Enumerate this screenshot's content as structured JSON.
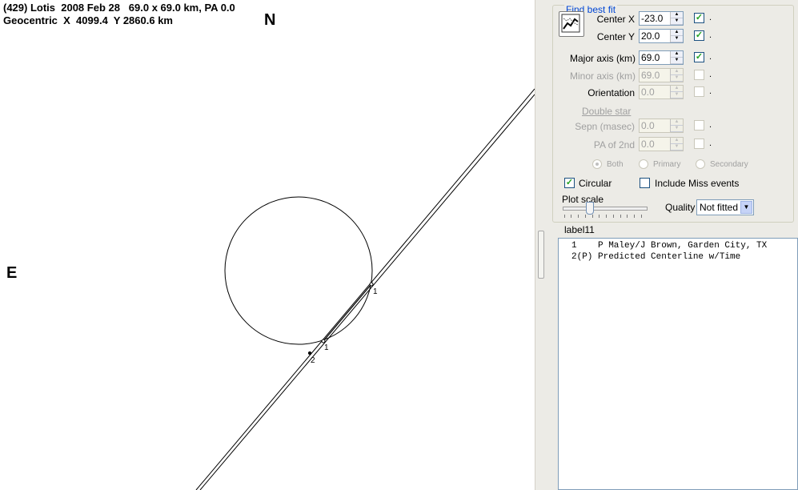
{
  "plot": {
    "header_line1": "(429) Lotis  2008 Feb 28   69.0 x 69.0 km, PA 0.0",
    "header_line2": "Geocentric  X  4099.4  Y 2860.6 km",
    "north_label": "N",
    "east_label": "E",
    "chord_labels": [
      "1",
      "1",
      "2"
    ]
  },
  "panel": {
    "group_title": "Find best fit",
    "fit_button_icon": "chart-fit-icon",
    "center_x": {
      "label": "Center X",
      "value": "-23.0",
      "checked": true
    },
    "center_y": {
      "label": "Center Y",
      "value": "20.0",
      "checked": true
    },
    "major_axis": {
      "label": "Major axis (km)",
      "value": "69.0",
      "checked": true
    },
    "minor_axis": {
      "label": "Minor axis (km)",
      "value": "69.0",
      "checked": false
    },
    "orientation": {
      "label": "Orientation",
      "value": "0.0",
      "checked": false
    },
    "double_star_link": "Double star",
    "sepn": {
      "label": "Sepn (masec)",
      "value": "0.0",
      "checked": false
    },
    "pa_2nd": {
      "label": "PA of 2nd",
      "value": "0.0",
      "checked": false
    },
    "dot": ".",
    "radio_both": "Both",
    "radio_primary": "Primary",
    "radio_secondary": "Secondary",
    "circular": {
      "label": "Circular",
      "checked": true
    },
    "include_miss": {
      "label": "Include Miss events",
      "checked": false
    },
    "plot_scale_label": "Plot scale",
    "quality_label": "Quality",
    "quality_value": "Not fitted",
    "label11": "label11",
    "list_rows": [
      "1    P Maley/J Brown, Garden City, TX",
      "2(P) Predicted Centerline w/Time"
    ]
  },
  "colors": {
    "group_title": "#0046d5",
    "check": "#21a121",
    "panel_bg": "#ecebe6"
  }
}
